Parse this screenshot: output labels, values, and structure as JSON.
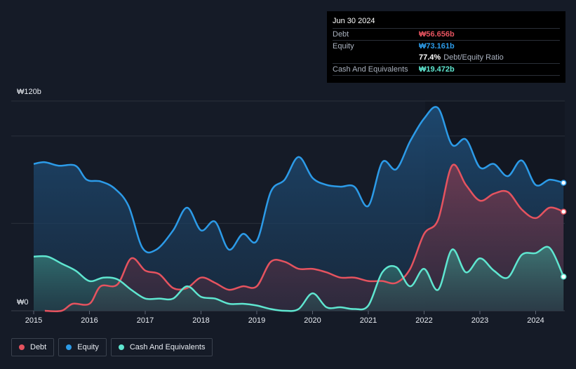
{
  "tooltip": {
    "date": "Jun 30 2024",
    "debt_label": "Debt",
    "debt_value": "₩56.656b",
    "equity_label": "Equity",
    "equity_value": "₩73.161b",
    "ratio_value": "77.4%",
    "ratio_label": "Debt/Equity Ratio",
    "cash_label": "Cash And Equivalents",
    "cash_value": "₩19.472b"
  },
  "legend": [
    {
      "label": "Debt",
      "color": "#e5535f"
    },
    {
      "label": "Equity",
      "color": "#2c9be8"
    },
    {
      "label": "Cash And Equivalents",
      "color": "#5fe6d0"
    }
  ],
  "chart_data": {
    "type": "area",
    "ylim": [
      0,
      120
    ],
    "y_tick_labels": [
      "₩120b",
      "₩0"
    ],
    "x_tick_labels": [
      "2015",
      "2016",
      "2017",
      "2018",
      "2019",
      "2020",
      "2021",
      "2022",
      "2023",
      "2024"
    ],
    "xlim": [
      2015,
      2024.5
    ],
    "grid": true,
    "legend_position": "bottom-left",
    "series": [
      {
        "name": "Equity",
        "color": "#2c9be8",
        "x": [
          2015,
          2015.2,
          2015.45,
          2015.75,
          2015.95,
          2016.2,
          2016.45,
          2016.7,
          2016.95,
          2017.2,
          2017.5,
          2017.75,
          2018,
          2018.25,
          2018.5,
          2018.75,
          2019,
          2019.25,
          2019.5,
          2019.75,
          2020,
          2020.25,
          2020.5,
          2020.75,
          2021,
          2021.25,
          2021.5,
          2021.75,
          2022,
          2022.25,
          2022.5,
          2022.75,
          2023,
          2023.25,
          2023.5,
          2023.75,
          2024,
          2024.25,
          2024.5
        ],
        "values": [
          84,
          85,
          83,
          83,
          75,
          74,
          70,
          60,
          36,
          35,
          46,
          59,
          46,
          51,
          35,
          44,
          40,
          68,
          75,
          88,
          76,
          72,
          71,
          71,
          60,
          85,
          81,
          97,
          110,
          116,
          95,
          98,
          82,
          84,
          77,
          86,
          72,
          75,
          73.2
        ]
      },
      {
        "name": "Debt",
        "color": "#e5535f",
        "x": [
          2015.2,
          2015.5,
          2015.7,
          2016,
          2016.2,
          2016.5,
          2016.75,
          2017,
          2017.25,
          2017.5,
          2017.75,
          2018,
          2018.25,
          2018.5,
          2018.75,
          2019,
          2019.25,
          2019.5,
          2019.75,
          2020,
          2020.25,
          2020.5,
          2020.75,
          2021,
          2021.25,
          2021.5,
          2021.75,
          2022,
          2022.25,
          2022.5,
          2022.75,
          2023,
          2023.25,
          2023.5,
          2023.75,
          2024,
          2024.25,
          2024.5
        ],
        "values": [
          0,
          0,
          4,
          4,
          14,
          15,
          30,
          23,
          21,
          13,
          13,
          19,
          16,
          12,
          14,
          14,
          28,
          28,
          24,
          24,
          22,
          19,
          19,
          17,
          17,
          16,
          24,
          44,
          52,
          83,
          72,
          63,
          67,
          68,
          58,
          53,
          59,
          56.7
        ]
      },
      {
        "name": "Cash And Equivalents",
        "color": "#5fe6d0",
        "x": [
          2015,
          2015.25,
          2015.5,
          2015.75,
          2016,
          2016.25,
          2016.5,
          2016.75,
          2017,
          2017.25,
          2017.5,
          2017.75,
          2018,
          2018.25,
          2018.5,
          2018.75,
          2019,
          2019.25,
          2019.5,
          2019.75,
          2020,
          2020.25,
          2020.5,
          2020.75,
          2021,
          2021.25,
          2021.5,
          2021.75,
          2022,
          2022.25,
          2022.5,
          2022.75,
          2023,
          2023.25,
          2023.5,
          2023.75,
          2024,
          2024.25,
          2024.5
        ],
        "values": [
          31,
          31,
          27,
          23,
          17,
          19,
          18,
          12,
          7,
          7,
          7,
          14,
          8,
          7,
          4,
          4,
          3,
          1,
          0,
          1,
          10,
          2,
          2,
          1,
          3,
          22,
          25,
          14,
          24,
          12,
          35,
          22,
          30,
          23,
          19,
          32,
          33,
          36,
          19.5
        ]
      }
    ]
  }
}
